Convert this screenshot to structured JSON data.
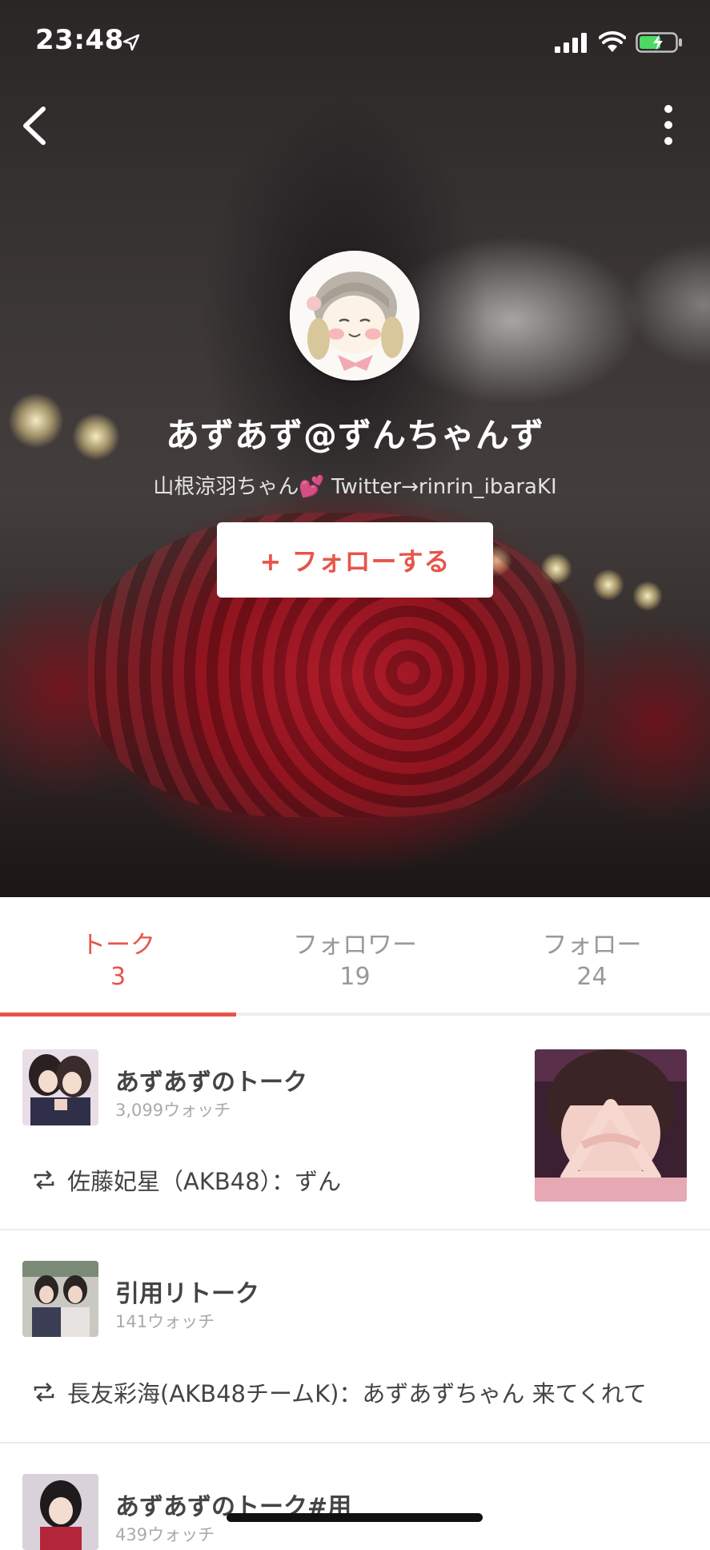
{
  "status_bar": {
    "time": "23:48",
    "icons": [
      "location-arrow-icon",
      "cellular-signal-icon",
      "wifi-icon",
      "battery-charging-icon"
    ]
  },
  "header": {
    "back_icon": "chevron-left-icon",
    "more_icon": "vertical-ellipsis-icon"
  },
  "profile": {
    "name": "あずあず@ずんちゃんず",
    "bio": "山根涼羽ちゃん💕 Twitter→rinrin_ibaraKI",
    "follow_label": "+ フォローする"
  },
  "tabs": [
    {
      "label": "トーク",
      "count": "3",
      "active": true
    },
    {
      "label": "フォロワー",
      "count": "19",
      "active": false
    },
    {
      "label": "フォロー",
      "count": "24",
      "active": false
    }
  ],
  "talks": [
    {
      "title": "あずあずのトーク",
      "watch": "3,099ウォッチ",
      "latest": "佐藤妃星（AKB48）：ずん",
      "has_image": true
    },
    {
      "title": "引用リトーク",
      "watch": "141ウォッチ",
      "latest": "長友彩海(AKB48チームK)：あずあずちゃん 来てくれて",
      "has_image": false
    },
    {
      "title": "あずあずのトーク#用",
      "watch": "439ウォッチ",
      "latest": "",
      "has_image": false
    }
  ],
  "colors": {
    "accent": "#e8544a",
    "tab_inactive": "#999999",
    "divider": "#ececec"
  }
}
